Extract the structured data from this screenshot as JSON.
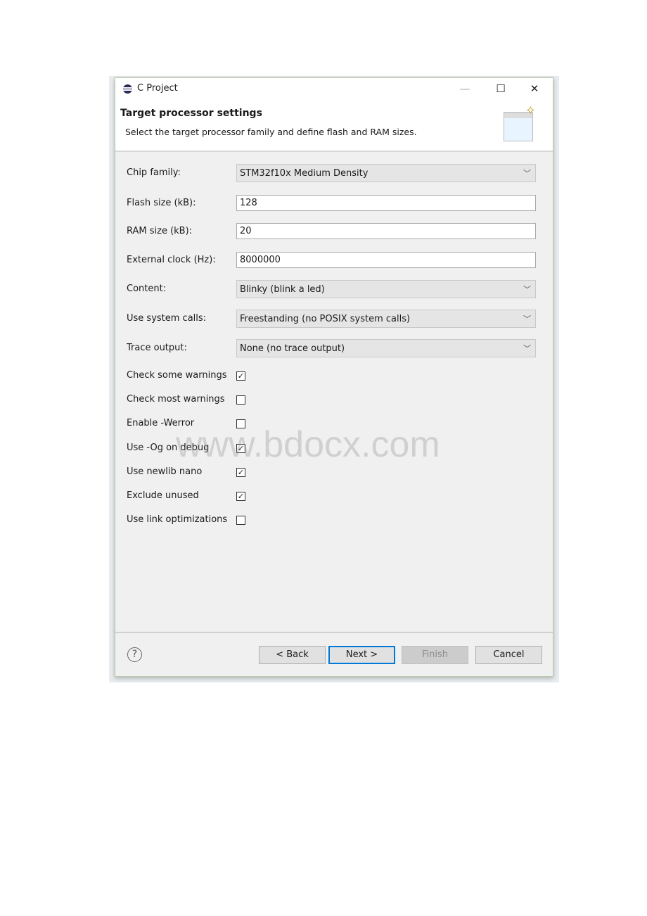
{
  "window": {
    "title": "C Project",
    "minimize": "—",
    "maximize": "☐",
    "close": "✕"
  },
  "header": {
    "title": "Target processor settings",
    "description": "Select the target processor family and define flash and RAM sizes."
  },
  "fields": [
    {
      "label": "Chip family:",
      "value": "STM32f10x Medium Density",
      "type": "combo"
    },
    {
      "label": "Flash size (kB):",
      "value": "128",
      "type": "text"
    },
    {
      "label": "RAM size (kB):",
      "value": "20",
      "type": "text"
    },
    {
      "label": "External clock (Hz):",
      "value": "8000000",
      "type": "text"
    },
    {
      "label": "Content:",
      "value": "Blinky (blink a led)",
      "type": "combo"
    },
    {
      "label": "Use system calls:",
      "value": "Freestanding (no POSIX system calls)",
      "type": "combo"
    },
    {
      "label": "Trace output:",
      "value": "None (no trace output)",
      "type": "combo"
    }
  ],
  "checkboxes": [
    {
      "label": "Check some warnings",
      "checked": true
    },
    {
      "label": "Check most warnings",
      "checked": false
    },
    {
      "label": "Enable -Werror",
      "checked": false
    },
    {
      "label": "Use -Og on debug",
      "checked": true
    },
    {
      "label": "Use newlib nano",
      "checked": true
    },
    {
      "label": "Exclude unused",
      "checked": true
    },
    {
      "label": "Use link optimizations",
      "checked": false
    }
  ],
  "footer": {
    "help": "?",
    "back": "< Back",
    "next": "Next >",
    "finish": "Finish",
    "cancel": "Cancel"
  },
  "watermark": "www.bdocx.com"
}
